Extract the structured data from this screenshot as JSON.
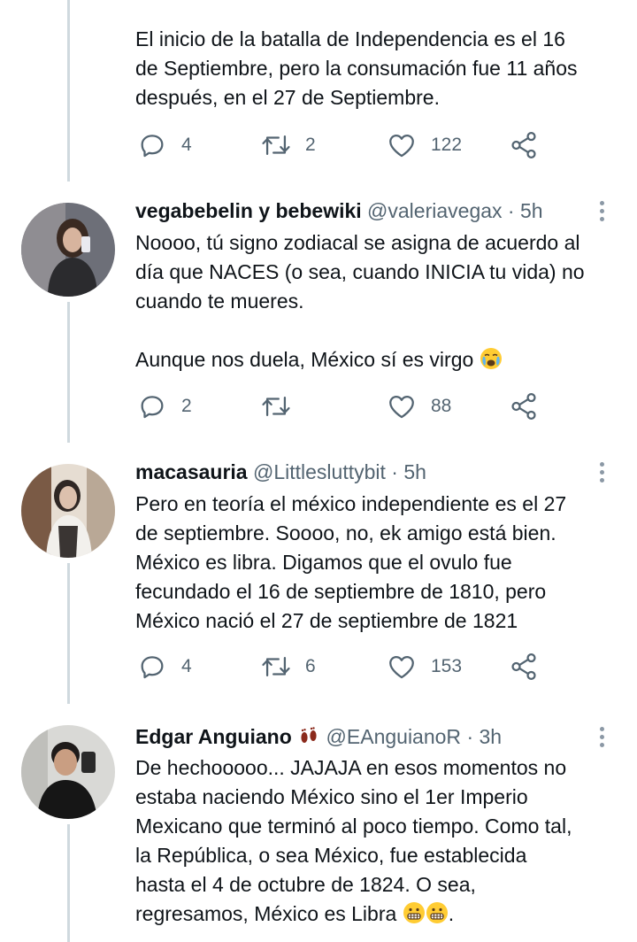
{
  "tweets": [
    {
      "id": "t0",
      "text": "El inicio de la batalla de Independencia es el 16\nde Septiembre, pero la consumación fue 11 años\ndespués, en el 27 de Septiembre.",
      "replies": "4",
      "retweets": "2",
      "likes": "122"
    },
    {
      "id": "t1",
      "name": "vegabebelin y bebewiki",
      "handle": "@valeriavegax",
      "time": "· 5h",
      "text": "Noooo, tú signo zodiacal se asigna de acuerdo al\ndía que NACES (o sea, cuando INICIA tu vida) no\ncuando te mueres.\n\nAunque nos duela, México sí es virgo",
      "replies": "2",
      "retweets": "",
      "likes": "88"
    },
    {
      "id": "t2",
      "name": "macasauria",
      "handle": "@Littlesluttybit",
      "time": "· 5h",
      "text": "Pero en teoría el méxico independiente es el 27\nde septiembre. Soooo, no, ek amigo está bien.\nMéxico es libra. Digamos que el ovulo fue\nfecundado el 16 de septiembre de 1810, pero\nMéxico nació el 27 de septiembre de 1821",
      "replies": "4",
      "retweets": "6",
      "likes": "153"
    },
    {
      "id": "t3",
      "name": "Edgar Anguiano",
      "handle": "@EAnguianoR",
      "time": "· 3h",
      "text": "De hechooooo... JAJAJA en esos momentos no\nestaba naciendo México sino el 1er Imperio\nMexicano que terminó al poco tiempo. Como tal,\nla República, o sea México, fue establecida\nhasta el 4 de octubre de 1824. O sea,\nregresamos, México es Libra",
      "text_end": "."
    }
  ],
  "colors": {
    "text": "#0f1419",
    "muted": "#536471",
    "thread_line": "#cfd9de"
  },
  "icons": [
    "reply-icon",
    "retweet-icon",
    "like-icon",
    "share-icon",
    "more-icon",
    "crying-emoji",
    "footprints-emoji",
    "grimacing-emoji"
  ]
}
